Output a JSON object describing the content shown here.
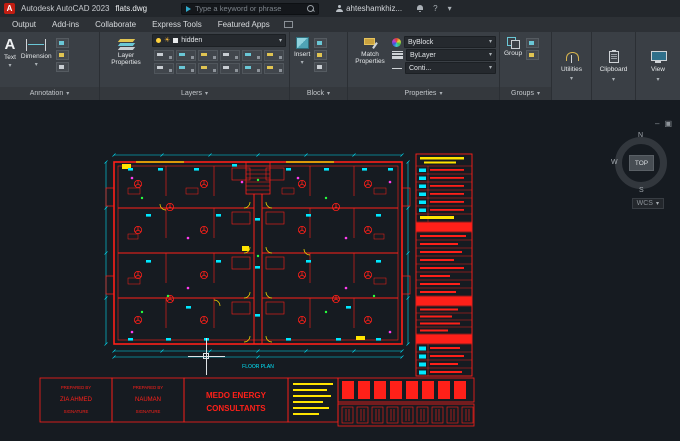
{
  "title_bar": {
    "logo_letter": "A",
    "app_title": "Autodesk AutoCAD 2023",
    "doc_title": "flats.dwg",
    "search_placeholder": "Type a keyword or phrase",
    "user_name": "ahteshamkhiz..."
  },
  "tabs": {
    "items": [
      "Output",
      "Add-ins",
      "Collaborate",
      "Express Tools",
      "Featured Apps"
    ]
  },
  "ribbon": {
    "annotation": {
      "text_label": "Text",
      "dimension_label": "Dimension",
      "panel_label": "Annotation"
    },
    "layers": {
      "button_label": "Layer Properties",
      "current_layer": "hidden",
      "panel_label": "Layers"
    },
    "block": {
      "insert_label": "Insert",
      "panel_label": "Block"
    },
    "properties": {
      "match_label": "Match Properties",
      "color_value": "ByBlock",
      "lineweight_value": "ByLayer",
      "linetype_value": "Conti...",
      "panel_label": "Properties"
    },
    "groups": {
      "group_label": "Group",
      "panel_label": "Groups"
    },
    "utilities_label": "Utilities",
    "clipboard_label": "Clipboard",
    "view_label": "View"
  },
  "canvas": {
    "viewcube": {
      "north": "N",
      "west": "W",
      "south": "S",
      "top": "TOP"
    },
    "wcs_label": "WCS"
  },
  "drawing": {
    "plan_caption": "FLOOR PLAN",
    "prepared_1": {
      "heading": "PREPARED BY",
      "name": "ZIA AHMED",
      "sub": "SIGNATURE"
    },
    "prepared_2": {
      "heading": "PREPARED BY",
      "name": "NAUMAN",
      "sub": "SIGNATURE"
    },
    "consultant_line1": "MEDO ENERGY",
    "consultant_line2": "CONSULTANTS"
  },
  "icons": {
    "chevron": "▾",
    "sun": "☀",
    "question": "?",
    "minus": "–",
    "layers_glyph": "▣"
  },
  "colors": {
    "cad_red": "#ff2019",
    "cad_cyan": "#00e8ff",
    "cad_yellow": "#ffe400",
    "cad_magenta": "#ff3df0",
    "cad_green": "#27ff3f",
    "ribbon_bg": "#3a3f45",
    "canvas_bg": "#161b21"
  }
}
